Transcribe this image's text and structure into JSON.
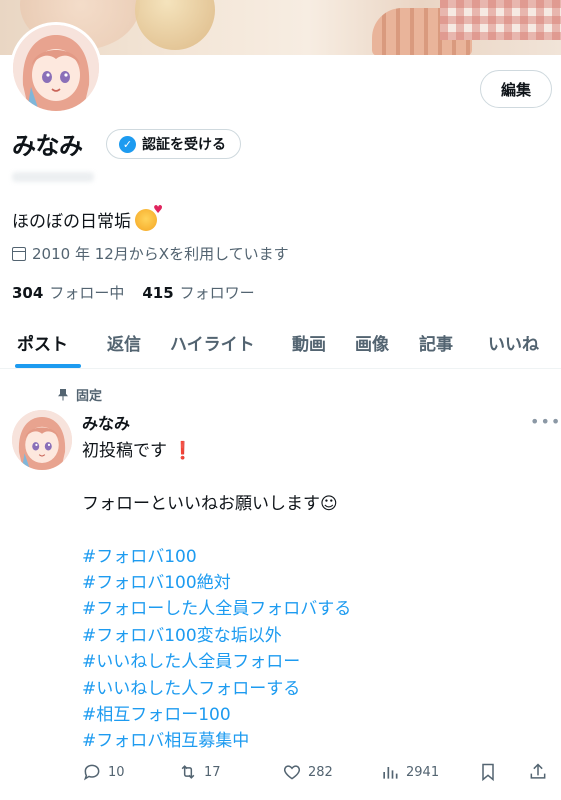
{
  "profile": {
    "name": "みなみ",
    "verify_label": "認証を受ける",
    "edit_label": "編集",
    "bio_text": "ほのぼの日常垢",
    "joined": "2010 年 12月からXを利用しています",
    "following_count": "304",
    "following_label": "フォロー中",
    "followers_count": "415",
    "followers_label": "フォロワー"
  },
  "tabs": [
    {
      "label": "ポスト"
    },
    {
      "label": "返信"
    },
    {
      "label": "ハイライト"
    },
    {
      "label": "動画"
    },
    {
      "label": "画像"
    },
    {
      "label": "記事"
    },
    {
      "label": "いいね"
    }
  ],
  "post": {
    "pinned_label": "固定",
    "author": "みなみ",
    "more": "•••",
    "first_line": "初投稿です",
    "second_line": "フォローといいねお願いします☺",
    "hashtags": [
      "#フォロバ100",
      "#フォロバ100絶対",
      "#フォローした人全員フォロバする",
      "#フォロバ100変な垢以外",
      "#いいねした人全員フォロー",
      "#いいねした人フォローする",
      "#相互フォロー100",
      "#フォロバ相互募集中"
    ],
    "replies": "10",
    "reposts": "17",
    "likes": "282",
    "views": "2941"
  },
  "colors": {
    "accent": "#1d9bf0",
    "text": "#0f1419",
    "muted": "#536471"
  }
}
